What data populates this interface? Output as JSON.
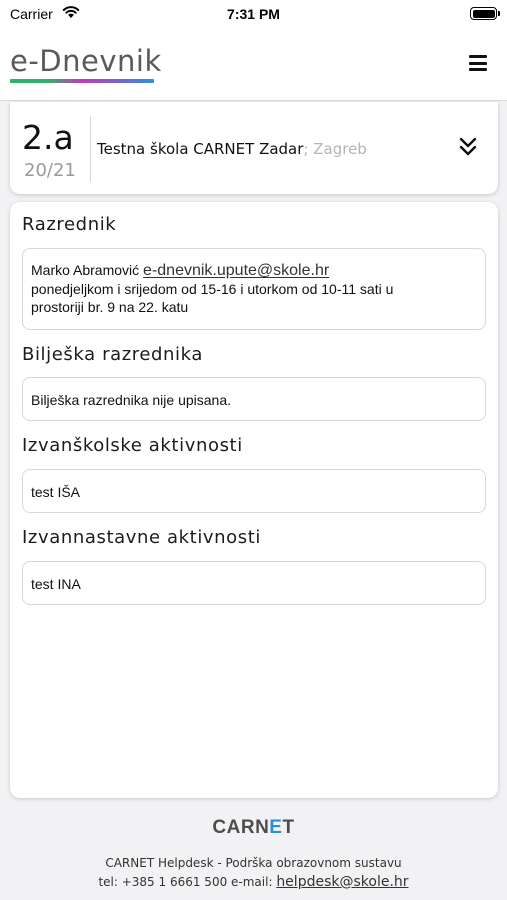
{
  "status_bar": {
    "carrier": "Carrier",
    "time": "7:31 PM",
    "icons": [
      "wifi-icon",
      "battery-icon"
    ]
  },
  "header": {
    "logo_text": "e-Dnevnik",
    "menu_icon": "hamburger-menu-icon",
    "logo_colors": [
      "#2fb36b",
      "#c23ab8",
      "#2e8fe0"
    ]
  },
  "class_info": {
    "class_name": "2.a",
    "school_year": "20/21",
    "school_name": "Testna škola CARNET Zadar",
    "city": "; Zagreb",
    "expand_icon": "double-chevron-down-icon"
  },
  "sections": {
    "razrednik": {
      "title": "Razrednik",
      "teacher_name": "Marko Abramović",
      "email": "e-dnevnik.upute@skole.hr",
      "hours_line1": "ponedjeljkom i srijedom od 15-16 i utorkom od 10-11 sati u",
      "hours_line2": "prostoriji br. 9 na 22. katu"
    },
    "biljeska": {
      "title": "Bilješka razrednika",
      "text": "Bilješka razrednika nije upisana."
    },
    "izvanskolske": {
      "title": "Izvanškolske aktivnosti",
      "text": "test IŠA"
    },
    "izvannastavne": {
      "title": "Izvannastavne aktivnosti",
      "text": "test INA"
    }
  },
  "footer": {
    "brand_left": "CARN",
    "brand_mid": "E",
    "brand_right": "T",
    "helpdesk": "CARNET Helpdesk - Podrška obrazovnom sustavu",
    "contact_prefix": "tel: +385 1 6661 500 e-mail: ",
    "contact_email": "helpdesk@skole.hr",
    "accent_color": "#2b8fd8"
  }
}
